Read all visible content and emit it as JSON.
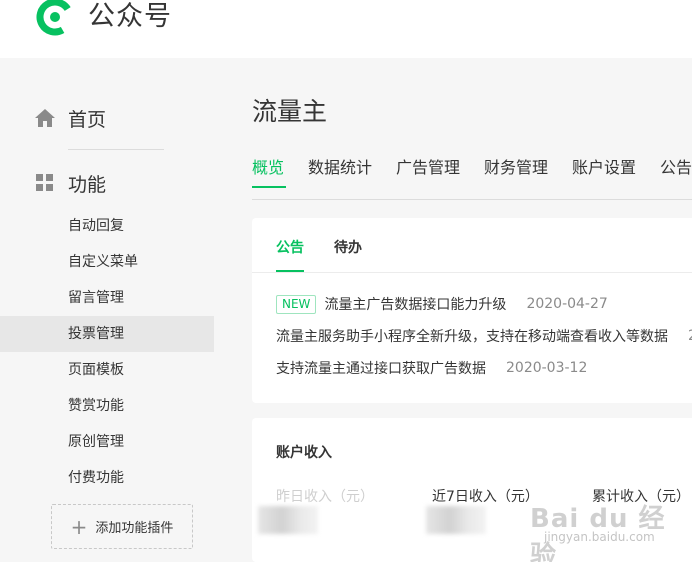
{
  "header": {
    "logo_icon": "wechat-official-account-logo-icon",
    "title": "公众号",
    "accent": "#07c160"
  },
  "sidebar": {
    "home": {
      "label": "首页",
      "icon": "home-icon"
    },
    "features": {
      "label": "功能",
      "icon": "grid-icon"
    },
    "items": [
      {
        "label": "自动回复"
      },
      {
        "label": "自定义菜单"
      },
      {
        "label": "留言管理"
      },
      {
        "label": "投票管理",
        "active": true
      },
      {
        "label": "页面模板"
      },
      {
        "label": "赞赏功能"
      },
      {
        "label": "原创管理"
      },
      {
        "label": "付费功能"
      }
    ],
    "add_plugin": "添加功能插件"
  },
  "main": {
    "title": "流量主",
    "tabs": [
      {
        "label": "概览",
        "active": true
      },
      {
        "label": "数据统计"
      },
      {
        "label": "广告管理"
      },
      {
        "label": "财务管理"
      },
      {
        "label": "账户设置"
      },
      {
        "label": "公告"
      }
    ],
    "notice_card": {
      "tabs": [
        {
          "label": "公告",
          "active": true
        },
        {
          "label": "待办"
        }
      ],
      "items": [
        {
          "badge": "NEW",
          "text": "流量主广告数据接口能力升级",
          "date": "2020-04-27"
        },
        {
          "badge": "",
          "text": "流量主服务助手小程序全新升级，支持在移动端查看收入等数据",
          "date": "2"
        },
        {
          "badge": "",
          "text": "支持流量主通过接口获取广告数据",
          "date": "2020-03-12"
        }
      ]
    },
    "income_card": {
      "title": "账户收入",
      "metrics": [
        {
          "label": "昨日收入（元）"
        },
        {
          "label": "近7日收入（元）"
        },
        {
          "label": "累计收入（元）"
        }
      ]
    }
  },
  "watermark": {
    "main": "Bai du 经验",
    "sub": "jingyan.baidu.com"
  }
}
